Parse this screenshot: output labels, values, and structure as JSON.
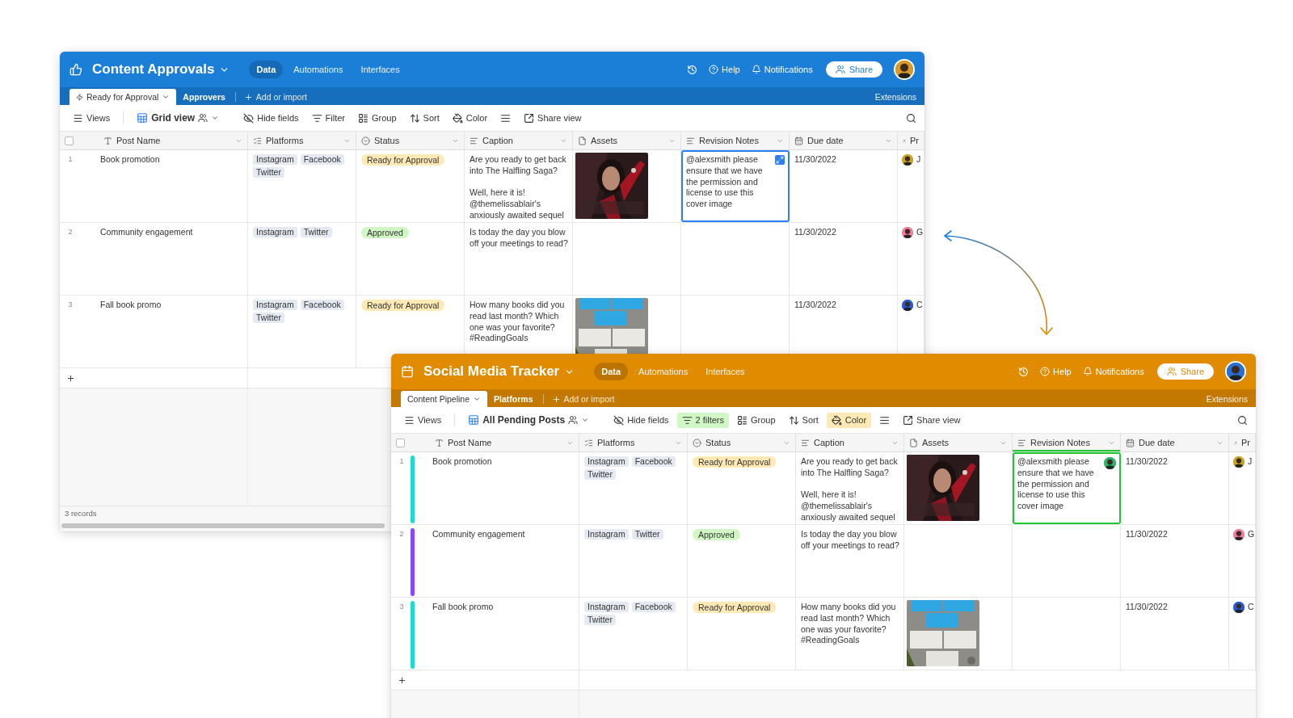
{
  "windows": [
    {
      "color": "#1b7fd8",
      "title": "Content Approvals",
      "nav_tabs": [
        {
          "label": "Data",
          "selected": true
        },
        {
          "label": "Automations",
          "selected": false
        },
        {
          "label": "Interfaces",
          "selected": false
        }
      ],
      "help": "Help",
      "notifications": "Notifications",
      "share": "Share",
      "avatar": {
        "color": "#d89b2b"
      },
      "table_tabs": [
        {
          "label": "Ready for Approval",
          "selected": true
        },
        {
          "label": "Approvers",
          "selected": false
        }
      ],
      "add_table": "Add or import",
      "extensions": "Extensions",
      "toolbar": [
        {
          "kind": "views",
          "label": "Views",
          "active": false
        },
        {
          "kind": "view",
          "label": "Grid view",
          "active": false
        },
        {
          "kind": "hide",
          "label": "Hide fields",
          "active": false
        },
        {
          "kind": "filter",
          "label": "Filter",
          "active": false
        },
        {
          "kind": "group",
          "label": "Group",
          "active": false
        },
        {
          "kind": "sort",
          "label": "Sort",
          "active": false
        },
        {
          "kind": "color",
          "label": "Color",
          "active": false
        },
        {
          "kind": "rowheight",
          "active": false
        },
        {
          "kind": "share",
          "label": "Share view",
          "active": false
        }
      ],
      "columns": [
        {
          "kind": "text",
          "label": "Post Name",
          "selected": false
        },
        {
          "kind": "multi",
          "label": "Platforms",
          "selected": false
        },
        {
          "kind": "status",
          "label": "Status",
          "selected": false
        },
        {
          "kind": "longtext",
          "label": "Caption",
          "selected": false
        },
        {
          "kind": "attachment",
          "label": "Assets",
          "selected": false
        },
        {
          "kind": "longtext",
          "label": "Revision Notes",
          "selected": false
        },
        {
          "kind": "date",
          "label": "Due date",
          "selected": false
        },
        {
          "kind": "user",
          "label": "Pr",
          "selected": false
        }
      ],
      "rows": [
        {
          "number": "1",
          "name": "Book promotion",
          "platforms": [
            "Instagram",
            "Facebook",
            "Twitter"
          ],
          "status": {
            "label": "Ready for Approval",
            "color": "#ffeab6"
          },
          "caption": "Are you ready to get back into The Halfling Saga?\n\nWell, here it is! @themelissablair's anxiously awaited sequel",
          "notes": {
            "text": "@alexsmith please ensure that we have the permission and license to use this cover image",
            "selected": true,
            "color": "#2d7ff9",
            "badge": {
              "kind": "expand"
            }
          },
          "due": "11/30/2022",
          "person": {
            "name": "J",
            "color": "#c9a227"
          }
        },
        {
          "number": "2",
          "name": "Community engagement",
          "platforms": [
            "Instagram",
            "Twitter"
          ],
          "status": {
            "label": "Approved",
            "color": "#d1f7c4"
          },
          "caption": "Is today the day you blow off your meetings to read?",
          "notes": {
            "selected": false
          },
          "due": "11/30/2022",
          "person": {
            "name": "G",
            "color": "#f07ca0"
          }
        },
        {
          "number": "3",
          "name": "Fall book promo",
          "platforms": [
            "Instagram",
            "Facebook",
            "Twitter"
          ],
          "status": {
            "label": "Ready for Approval",
            "color": "#ffeab6"
          },
          "caption": "How many books did you read last month? Which one was your favorite? #ReadingGoals",
          "notes": {
            "selected": false
          },
          "due": "11/30/2022",
          "person": {
            "name": "C",
            "color": "#2a5bd7"
          }
        }
      ],
      "footer": "3 records"
    },
    {
      "color": "#e08b00",
      "title": "Social Media Tracker",
      "nav_tabs": [
        {
          "label": "Data",
          "selected": true
        },
        {
          "label": "Automations",
          "selected": false
        },
        {
          "label": "Interfaces",
          "selected": false
        }
      ],
      "help": "Help",
      "notifications": "Notifications",
      "share": "Share",
      "avatar": {
        "color": "#2a6fd6"
      },
      "table_tabs": [
        {
          "label": "Content Pipeline",
          "selected": true
        },
        {
          "label": "Platforms",
          "selected": false
        }
      ],
      "add_table": "Add or import",
      "extensions": "Extensions",
      "toolbar": [
        {
          "kind": "views",
          "label": "Views",
          "active": false
        },
        {
          "kind": "view",
          "label": "All Pending Posts",
          "active": false
        },
        {
          "kind": "hide",
          "label": "Hide fields",
          "active": false
        },
        {
          "kind": "filter",
          "label": "2 filters",
          "active": true
        },
        {
          "kind": "group",
          "label": "Group",
          "active": false
        },
        {
          "kind": "sort",
          "label": "Sort",
          "active": false
        },
        {
          "kind": "color",
          "label": "Color",
          "active": true
        },
        {
          "kind": "rowheight",
          "active": false
        },
        {
          "kind": "share",
          "label": "Share view",
          "active": false
        }
      ],
      "columns": [
        {
          "kind": "text",
          "label": "Post Name",
          "selected": false
        },
        {
          "kind": "multi",
          "label": "Platforms",
          "selected": false
        },
        {
          "kind": "status",
          "label": "Status",
          "selected": false
        },
        {
          "kind": "longtext",
          "label": "Caption",
          "selected": false
        },
        {
          "kind": "attachment",
          "label": "Assets",
          "selected": false
        },
        {
          "kind": "longtext",
          "label": "Revision Notes",
          "selected": true
        },
        {
          "kind": "date",
          "label": "Due date",
          "selected": false
        },
        {
          "kind": "user",
          "label": "Pr",
          "selected": false
        }
      ],
      "rows": [
        {
          "number": "1",
          "color": "#20d9d2",
          "name": "Book promotion",
          "platforms": [
            "Instagram",
            "Facebook",
            "Twitter"
          ],
          "status": {
            "label": "Ready for Approval",
            "color": "#ffeab6"
          },
          "caption": "Are you ready to get back into The Halfling Saga?\n\nWell, here it is! @themelissablair's anxiously awaited sequel",
          "notes": {
            "text": "@alexsmith please ensure that we have the permission and license to use this cover image",
            "selected": true,
            "color": "#20c933",
            "badge": {
              "kind": "avatar",
              "color": "#2db36a"
            }
          },
          "due": "11/30/2022",
          "person": {
            "name": "J",
            "color": "#c9a227"
          }
        },
        {
          "number": "2",
          "color": "#8b46ff",
          "name": "Community engagement",
          "platforms": [
            "Instagram",
            "Twitter"
          ],
          "status": {
            "label": "Approved",
            "color": "#d1f7c4"
          },
          "caption": "Is today the day you blow off your meetings to read?",
          "notes": {
            "selected": false
          },
          "due": "11/30/2022",
          "person": {
            "name": "G",
            "color": "#f07ca0"
          }
        },
        {
          "number": "3",
          "color": "#20d9d2",
          "name": "Fall book promo",
          "platforms": [
            "Instagram",
            "Facebook",
            "Twitter"
          ],
          "status": {
            "label": "Ready for Approval",
            "color": "#ffeab6"
          },
          "caption": "How many books did you read last month? Which one was your favorite? #ReadingGoals",
          "notes": {
            "selected": false
          },
          "due": "11/30/2022",
          "person": {
            "name": "C",
            "color": "#2a5bd7"
          }
        }
      ]
    }
  ]
}
